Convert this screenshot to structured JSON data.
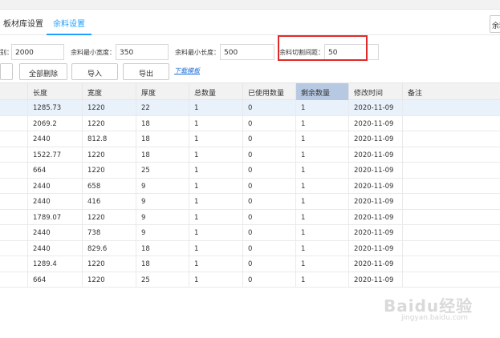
{
  "tabs": [
    {
      "label": "板材库设置",
      "active": false
    },
    {
      "label": "余料设置",
      "active": true
    }
  ],
  "right_button_label": "余料",
  "settings": {
    "label_1": "别：",
    "value_1": "2000",
    "label_2": "余料最小宽度：",
    "value_2": "350",
    "label_3": "余料最小长度：",
    "value_3": "500",
    "label_4": "余料切割间距：",
    "value_4": "50"
  },
  "toolbar": {
    "delete_all": "全部删除",
    "import": "导入",
    "export": "导出",
    "download_template": "下载模板"
  },
  "table": {
    "columns": [
      "长度",
      "宽度",
      "厚度",
      "总数量",
      "已使用数量",
      "剩余数量",
      "修改时间",
      "备注"
    ],
    "rows": [
      [
        "1285.73",
        "1220",
        "22",
        "1",
        "0",
        "1",
        "2020-11-09",
        ""
      ],
      [
        "2069.2",
        "1220",
        "18",
        "1",
        "0",
        "1",
        "2020-11-09",
        ""
      ],
      [
        "2440",
        "812.8",
        "18",
        "1",
        "0",
        "1",
        "2020-11-09",
        ""
      ],
      [
        "1522.77",
        "1220",
        "18",
        "1",
        "0",
        "1",
        "2020-11-09",
        ""
      ],
      [
        "664",
        "1220",
        "25",
        "1",
        "0",
        "1",
        "2020-11-09",
        ""
      ],
      [
        "2440",
        "658",
        "9",
        "1",
        "0",
        "1",
        "2020-11-09",
        ""
      ],
      [
        "2440",
        "416",
        "9",
        "1",
        "0",
        "1",
        "2020-11-09",
        ""
      ],
      [
        "1789.07",
        "1220",
        "9",
        "1",
        "0",
        "1",
        "2020-11-09",
        ""
      ],
      [
        "2440",
        "738",
        "9",
        "1",
        "0",
        "1",
        "2020-11-09",
        ""
      ],
      [
        "2440",
        "829.6",
        "18",
        "1",
        "0",
        "1",
        "2020-11-09",
        ""
      ],
      [
        "1289.4",
        "1220",
        "18",
        "1",
        "0",
        "1",
        "2020-11-09",
        ""
      ],
      [
        "664",
        "1220",
        "25",
        "1",
        "0",
        "1",
        "2020-11-09",
        ""
      ]
    ]
  },
  "watermark": {
    "main": "Baidu经验",
    "sub": "jingyan.baidu.com"
  },
  "colors": {
    "accent": "#1e9fff",
    "highlight_box": "#e02a2a",
    "sorted_header": "#b7c9e2",
    "selected_row": "#e9f1fb"
  }
}
